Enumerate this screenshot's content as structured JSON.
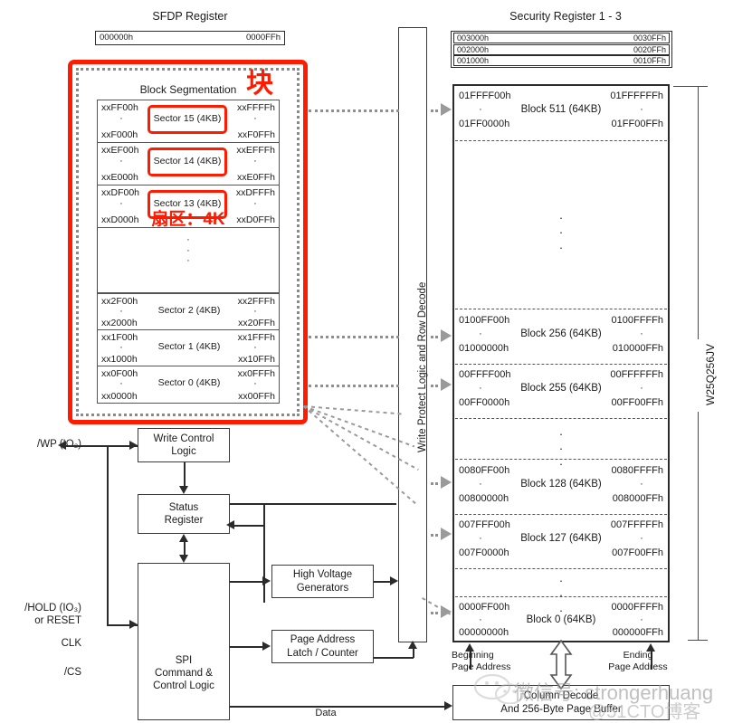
{
  "diagram": {
    "title_sfdp": "SFDP Register",
    "title_security": "Security Register 1 - 3",
    "device_label": "W25Q256JV",
    "block_segmentation_label": "Block Segmentation",
    "annotations": {
      "block_cn": "块",
      "sector_cn": "扇区：4K"
    },
    "watermark": {
      "wechat": "微信号: strongerhuang",
      "site": "@51CTO博客"
    }
  },
  "sfdp_register": {
    "start": "000000h",
    "end": "0000FFh"
  },
  "security_registers": [
    {
      "start": "003000h",
      "end": "0030FFh"
    },
    {
      "start": "002000h",
      "end": "0020FFh"
    },
    {
      "start": "001000h",
      "end": "0010FFh"
    }
  ],
  "sectors": [
    {
      "start": "xxFF00h",
      "label": "Sector 15 (4KB)",
      "end": "xxFFFFh",
      "start_low": "xxF000h",
      "end_low": "xxF0FFh",
      "highlight": true
    },
    {
      "start": "xxEF00h",
      "label": "Sector 14 (4KB)",
      "end": "xxEFFFh",
      "start_low": "xxE000h",
      "end_low": "xxE0FFh",
      "highlight": true
    },
    {
      "start": "xxDF00h",
      "label": "Sector 13 (4KB)",
      "end": "xxDFFFh",
      "start_low": "xxD000h",
      "end_low": "xxD0FFh",
      "highlight": true
    },
    {
      "start": "xx2F00h",
      "label": "Sector 2 (4KB)",
      "end": "xx2FFFh",
      "start_low": "xx2000h",
      "end_low": "xx20FFh",
      "highlight": false
    },
    {
      "start": "xx1F00h",
      "label": "Sector 1 (4KB)",
      "end": "xx1FFFh",
      "start_low": "xx1000h",
      "end_low": "xx10FFh",
      "highlight": false
    },
    {
      "start": "xx0F00h",
      "label": "Sector 0 (4KB)",
      "end": "xx0FFFh",
      "start_low": "xx0000h",
      "end_low": "xx00FFh",
      "highlight": false
    }
  ],
  "memory_blocks": [
    {
      "start": "01FFFF00h",
      "label": "Block 511 (64KB)",
      "end": "01FFFFFFh",
      "start_low": "01FF0000h",
      "end_low": "01FF00FFh"
    },
    {
      "start": "0100FF00h",
      "label": "Block 256 (64KB)",
      "end": "0100FFFFh",
      "start_low": "01000000h",
      "end_low": "010000FFh"
    },
    {
      "start": "00FFFF00h",
      "label": "Block 255 (64KB)",
      "end": "00FFFFFFh",
      "start_low": "00FF0000h",
      "end_low": "00FF00FFh"
    },
    {
      "start": "0080FF00h",
      "label": "Block 128 (64KB)",
      "end": "0080FFFFh",
      "start_low": "00800000h",
      "end_low": "008000FFh"
    },
    {
      "start": "007FFF00h",
      "label": "Block 127 (64KB)",
      "end": "007FFFFFh",
      "start_low": "007F0000h",
      "end_low": "007F00FFh"
    },
    {
      "start": "0000FF00h",
      "label": "Block 0 (64KB)",
      "end": "0000FFFFh",
      "start_low": "00000000h",
      "end_low": "000000FFh"
    }
  ],
  "logic_blocks": {
    "write_protect": "Write Protect Logic and Row Decode",
    "write_control": "Write Control\nLogic",
    "status_register": "Status\nRegister",
    "high_voltage": "High Voltage\nGenerators",
    "page_address": "Page Address\nLatch / Counter",
    "spi_logic": "SPI\nCommand &\nControl Logic",
    "column_decode": "Column Decode\nAnd 256-Byte Page Buffer"
  },
  "pins": {
    "wp": "/WP (IO₂)",
    "hold": "/HOLD (IO₃)\nor RESET",
    "clk": "CLK",
    "cs": "/CS"
  },
  "address_labels": {
    "beginning": "Beginning\nPage Address",
    "ending": "Ending\nPage Address",
    "data": "Data"
  }
}
